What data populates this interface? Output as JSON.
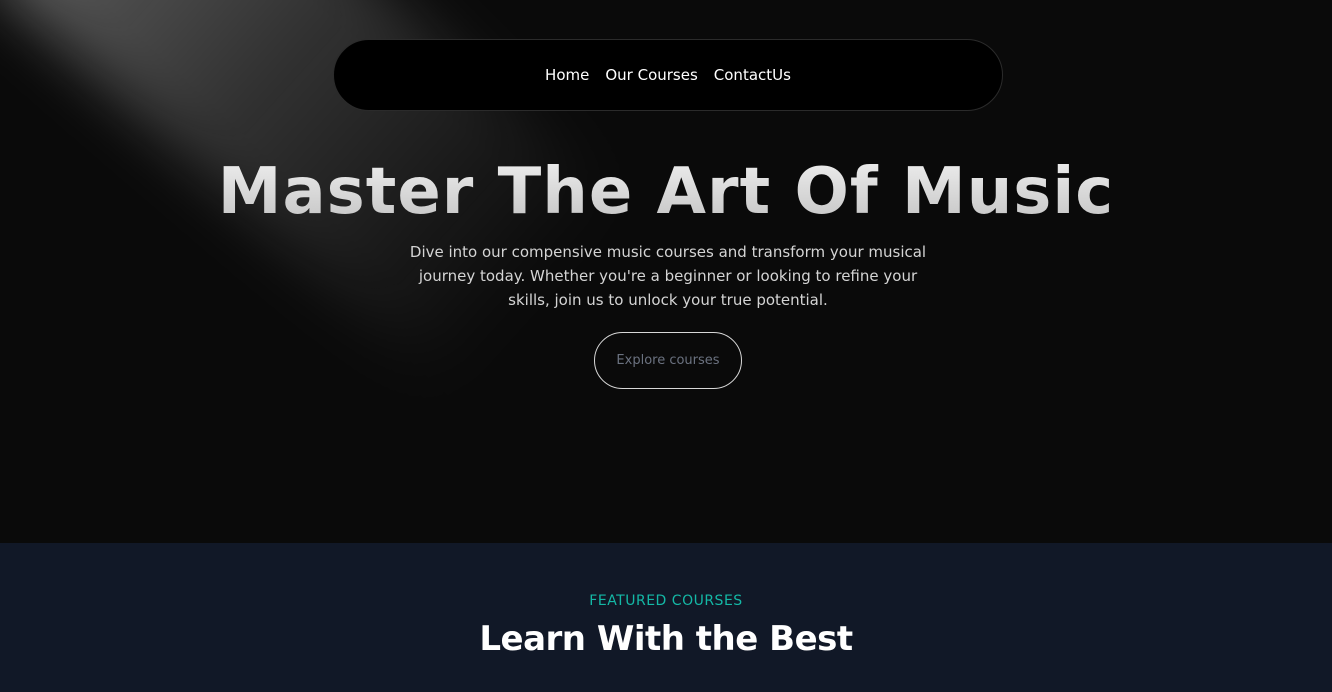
{
  "nav": {
    "items": [
      {
        "label": "Home"
      },
      {
        "label": "Our Courses"
      },
      {
        "label": "ContactUs"
      }
    ]
  },
  "hero": {
    "title": "Master The Art Of Music",
    "description": "Dive into our compensive music courses and transform your musical journey today. Whether you're a beginner or looking to refine your skills, join us to unlock your true potential.",
    "cta_label": "Explore courses"
  },
  "featured": {
    "eyebrow": "FEATURED COURSES",
    "title": "Learn With the Best"
  },
  "colors": {
    "hero_background": "#0a0a0a",
    "section_background": "#111827",
    "accent": "#14b8a6",
    "button_text": "#6b7280"
  }
}
